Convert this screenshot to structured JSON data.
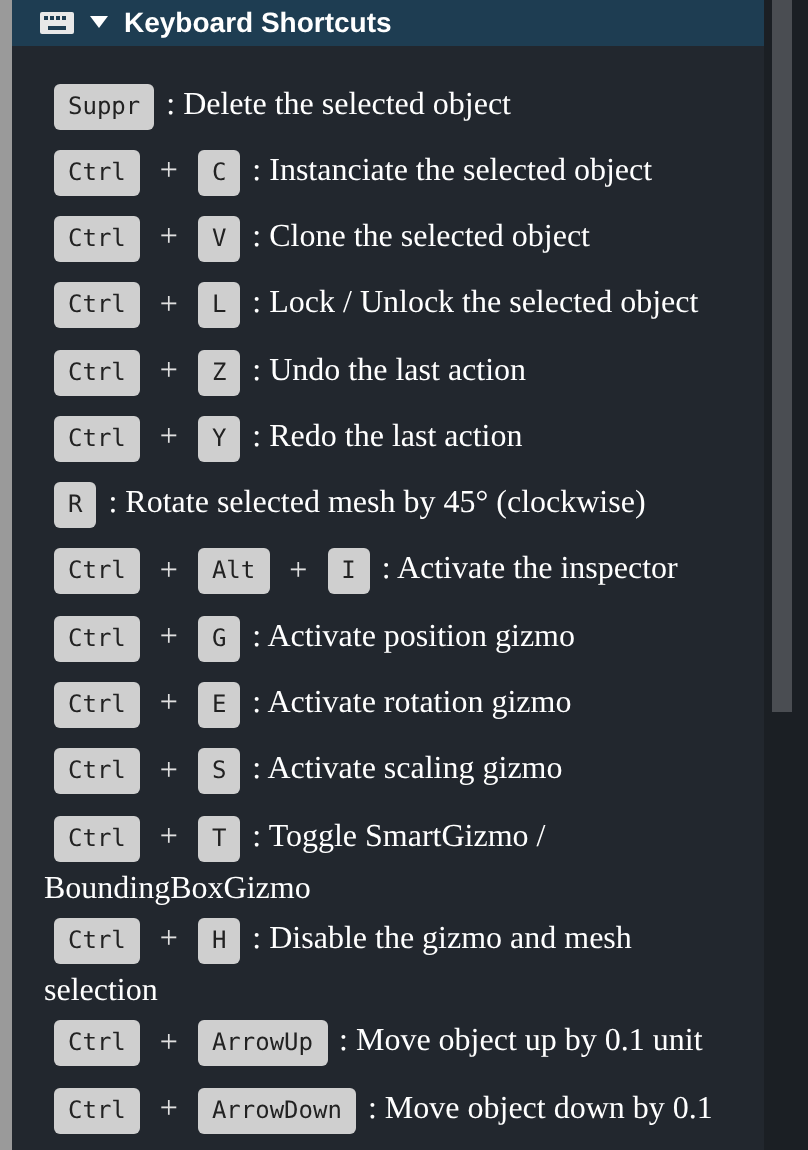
{
  "panel": {
    "title": "Keyboard Shortcuts",
    "expanded": true
  },
  "shortcuts": [
    {
      "keys": [
        {
          "kind": "key",
          "text": "Suppr"
        }
      ],
      "description": ": Delete the selected object"
    },
    {
      "keys": [
        {
          "kind": "key",
          "text": "Ctrl"
        },
        {
          "kind": "plus",
          "text": "+"
        },
        {
          "kind": "key",
          "text": "C"
        }
      ],
      "description": ": Instanciate the selected object"
    },
    {
      "keys": [
        {
          "kind": "key",
          "text": "Ctrl"
        },
        {
          "kind": "plus",
          "text": "+"
        },
        {
          "kind": "key",
          "text": "V"
        }
      ],
      "description": ": Clone the selected object"
    },
    {
      "keys": [
        {
          "kind": "key",
          "text": "Ctrl"
        },
        {
          "kind": "plus",
          "text": "+"
        },
        {
          "kind": "key",
          "text": "L"
        }
      ],
      "description": ": Lock / Unlock the selected object"
    },
    {
      "keys": [
        {
          "kind": "key",
          "text": "Ctrl"
        },
        {
          "kind": "plus",
          "text": "+"
        },
        {
          "kind": "key",
          "text": "Z"
        }
      ],
      "description": ": Undo the last action"
    },
    {
      "keys": [
        {
          "kind": "key",
          "text": "Ctrl"
        },
        {
          "kind": "plus",
          "text": "+"
        },
        {
          "kind": "key",
          "text": "Y"
        }
      ],
      "description": ": Redo the last action"
    },
    {
      "keys": [
        {
          "kind": "key",
          "text": "R"
        }
      ],
      "description": ": Rotate selected mesh by 45° (clockwise)"
    },
    {
      "keys": [
        {
          "kind": "key",
          "text": "Ctrl"
        },
        {
          "kind": "plus",
          "text": "+"
        },
        {
          "kind": "key",
          "text": "Alt"
        },
        {
          "kind": "plus",
          "text": "+"
        },
        {
          "kind": "key",
          "text": "I"
        }
      ],
      "description": ": Activate the inspector"
    },
    {
      "keys": [
        {
          "kind": "key",
          "text": "Ctrl"
        },
        {
          "kind": "plus",
          "text": "+"
        },
        {
          "kind": "key",
          "text": "G"
        }
      ],
      "description": ": Activate position gizmo"
    },
    {
      "keys": [
        {
          "kind": "key",
          "text": "Ctrl"
        },
        {
          "kind": "plus",
          "text": "+"
        },
        {
          "kind": "key",
          "text": "E"
        }
      ],
      "description": ": Activate rotation gizmo"
    },
    {
      "keys": [
        {
          "kind": "key",
          "text": "Ctrl"
        },
        {
          "kind": "plus",
          "text": "+"
        },
        {
          "kind": "key",
          "text": "S"
        }
      ],
      "description": ": Activate scaling gizmo"
    },
    {
      "keys": [
        {
          "kind": "key",
          "text": "Ctrl"
        },
        {
          "kind": "plus",
          "text": "+"
        },
        {
          "kind": "key",
          "text": "T"
        }
      ],
      "description": ": Toggle SmartGizmo /",
      "continuation": "BoundingBoxGizmo"
    },
    {
      "keys": [
        {
          "kind": "key",
          "text": "Ctrl"
        },
        {
          "kind": "plus",
          "text": "+"
        },
        {
          "kind": "key",
          "text": "H"
        }
      ],
      "description": ": Disable the gizmo and mesh",
      "continuation": "selection"
    },
    {
      "keys": [
        {
          "kind": "key",
          "text": "Ctrl"
        },
        {
          "kind": "plus",
          "text": "+"
        },
        {
          "kind": "key",
          "text": "ArrowUp"
        }
      ],
      "description": ": Move object up by 0.1 unit"
    },
    {
      "keys": [
        {
          "kind": "key",
          "text": "Ctrl"
        },
        {
          "kind": "plus",
          "text": "+"
        },
        {
          "kind": "key",
          "text": "ArrowDown"
        }
      ],
      "description": ": Move object down by 0.1"
    }
  ]
}
